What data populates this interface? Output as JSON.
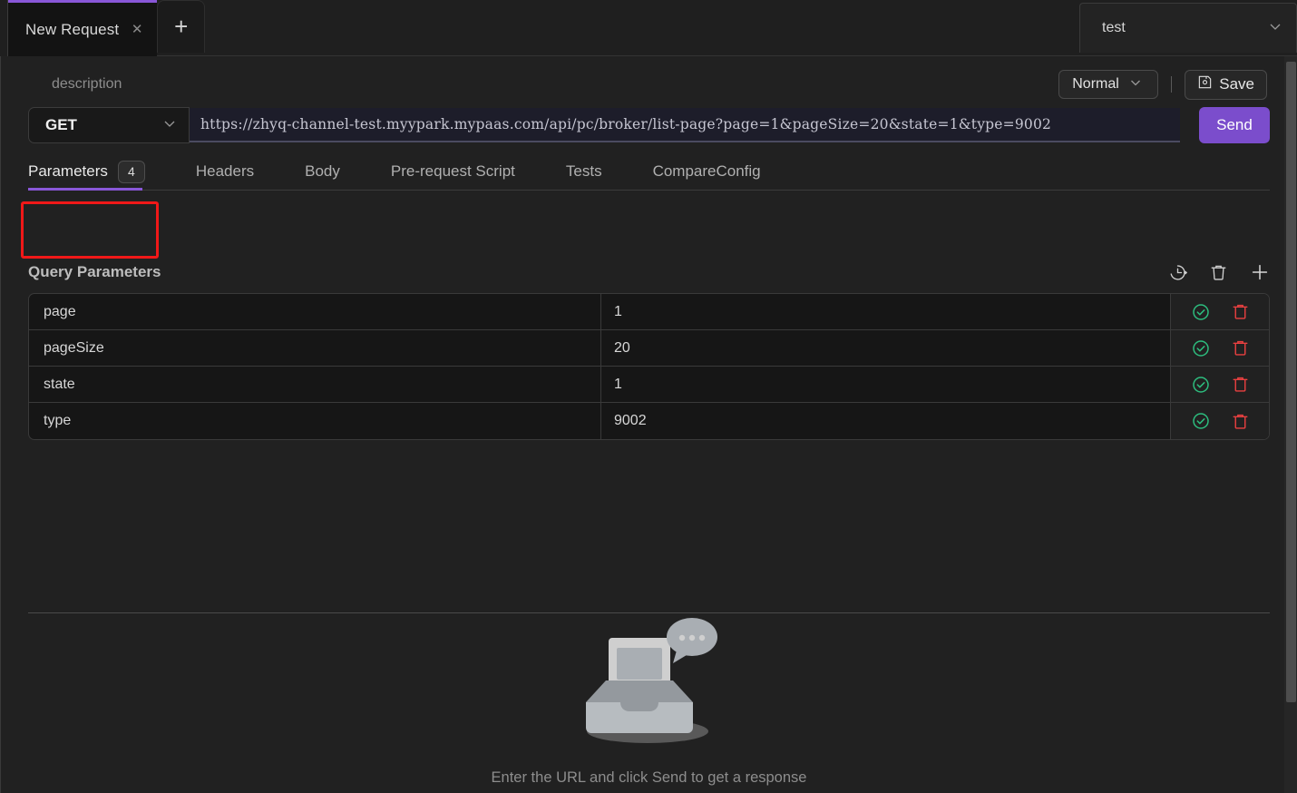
{
  "tabbar": {
    "tabs": [
      {
        "title": "New Request",
        "close_icon": "close-icon"
      }
    ],
    "add_tab_label": "+",
    "environment": {
      "label": "test",
      "chevron": "chevron-down-icon"
    }
  },
  "request": {
    "description_placeholder": "description",
    "mode": {
      "label": "Normal",
      "chevron": "chevron-down-icon"
    },
    "save": {
      "label": "Save",
      "icon": "save-disk-icon"
    },
    "method": {
      "label": "GET",
      "chevron": "chevron-down-icon"
    },
    "url": "https://zhyq-channel-test.myypark.mypaas.com/api/pc/broker/list-page?page=1&pageSize=20&state=1&type=9002",
    "send_label": "Send"
  },
  "section_tabs": [
    {
      "label": "Parameters",
      "badge": "4",
      "active": true
    },
    {
      "label": "Headers",
      "badge": null,
      "active": false
    },
    {
      "label": "Body",
      "badge": null,
      "active": false
    },
    {
      "label": "Pre-request Script",
      "badge": null,
      "active": false
    },
    {
      "label": "Tests",
      "badge": null,
      "active": false
    },
    {
      "label": "CompareConfig",
      "badge": null,
      "active": false
    }
  ],
  "query_parameters": {
    "title": "Query Parameters",
    "actions": [
      {
        "name": "history-restore-icon"
      },
      {
        "name": "delete-all-icon"
      },
      {
        "name": "add-param-icon"
      }
    ],
    "rows": [
      {
        "key": "page",
        "value": "1"
      },
      {
        "key": "pageSize",
        "value": "20"
      },
      {
        "key": "state",
        "value": "1"
      },
      {
        "key": "type",
        "value": "9002"
      }
    ],
    "row_actions": [
      {
        "name": "enabled-check-icon"
      },
      {
        "name": "delete-row-icon"
      }
    ]
  },
  "response": {
    "empty_message": "Enter the URL and click Send to get a response",
    "illustration": "empty-inbox-illustration"
  },
  "colors": {
    "accent_purple": "#8957d8",
    "send_button": "#7b4dcc",
    "highlight_red": "#f01818",
    "check_green": "#2dbd7e",
    "trash_red": "#e84040",
    "background": "#212121"
  }
}
